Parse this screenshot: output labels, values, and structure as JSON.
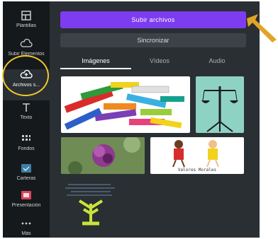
{
  "sidebar": {
    "items": [
      {
        "label": "Plantillas",
        "icon": "templates-icon"
      },
      {
        "label": "Subir Elementos",
        "icon": "upload-cloud-icon"
      },
      {
        "label": "Archivos s...",
        "icon": "cloud-icon"
      },
      {
        "label": "Texto",
        "icon": "text-icon"
      },
      {
        "label": "Fondos",
        "icon": "background-icon"
      },
      {
        "label": "Carteras",
        "icon": "image-icon"
      },
      {
        "label": "Presentación",
        "icon": "video-icon"
      },
      {
        "label": "Más",
        "icon": "more-dots-icon"
      }
    ]
  },
  "panel": {
    "upload_label": "Subir archivos",
    "sync_label": "Sincronizar",
    "tabs": [
      {
        "label": "Imágenes"
      },
      {
        "label": "Vídeos"
      },
      {
        "label": "Audio"
      }
    ],
    "thumbnails": [
      {
        "name": "colorful-word-labels-image"
      },
      {
        "name": "scales-tree-image"
      },
      {
        "name": "purple-flower-image"
      },
      {
        "name": "kids-values-image",
        "caption": "Valores Morales"
      },
      {
        "name": "word-tree-image"
      }
    ]
  },
  "colors": {
    "accent": "#7d3cf0",
    "highlight": "#f0c92a",
    "arrow": "#e0a526"
  }
}
